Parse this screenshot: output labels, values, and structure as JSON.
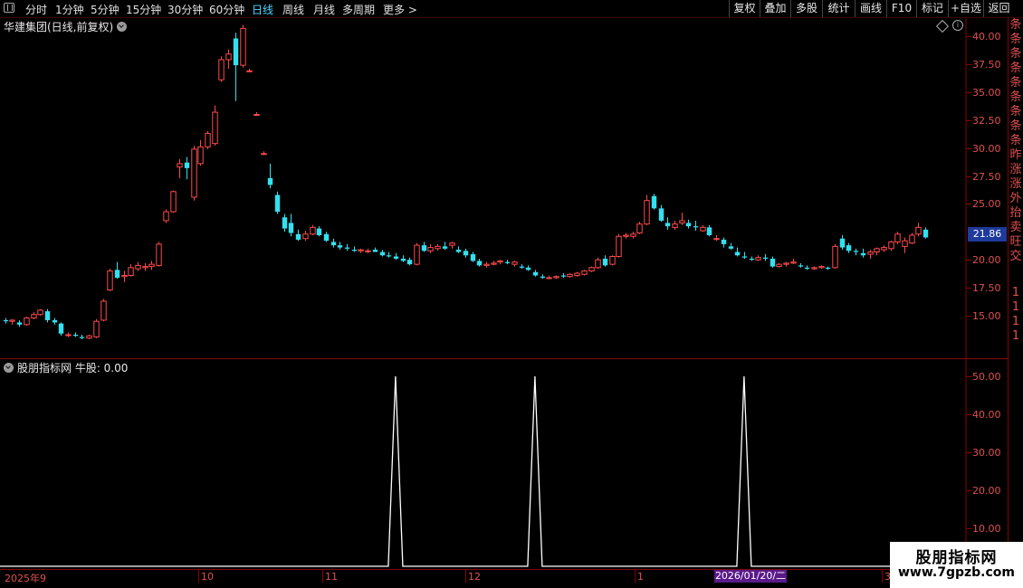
{
  "toolbar": {
    "tabs": [
      "分时",
      "1分钟",
      "5分钟",
      "15分钟",
      "30分钟",
      "60分钟",
      "日线",
      "周线",
      "月线",
      "多周期",
      "更多 >"
    ],
    "active_tab": "日线",
    "right_buttons": [
      "复权",
      "叠加",
      "多股",
      "统计",
      "画线",
      "F10",
      "标记",
      "+自选",
      "返回"
    ]
  },
  "main_chart": {
    "title": "华建集团(日线,前复权)",
    "current_price": "21.86",
    "y_ticks": [
      "40.00",
      "37.50",
      "35.00",
      "32.50",
      "30.00",
      "27.50",
      "25.00",
      "20.00",
      "17.50",
      "15.00"
    ]
  },
  "indicator": {
    "title": "股朋指标网  牛股: 0.00",
    "y_ticks": [
      "50.00",
      "40.00",
      "30.00",
      "20.00",
      "10.00"
    ]
  },
  "x_axis": {
    "labels": [
      "2025年9",
      "10",
      "11",
      "12",
      "1",
      "3"
    ],
    "highlight_date": "2026/01/20/二"
  },
  "side_column": [
    "条",
    "条",
    "条",
    "条",
    "条",
    "条",
    "条",
    "条",
    "条",
    "昨",
    "涨",
    "涨",
    "外",
    "抬",
    "卖",
    "旺",
    "交",
    "1",
    "1",
    "1",
    "1"
  ],
  "watermark": {
    "title": "股朋指标网",
    "url": "www.7gpzb.com"
  },
  "colors": {
    "up": "#ff4a4a",
    "down": "#33e0f0",
    "axis": "#8a0000",
    "text_axis": "#e05050",
    "active_tab": "#4fd7ff"
  },
  "chart_data": [
    {
      "type": "candlestick",
      "title": "华建集团(日线,前复权)",
      "ylim": [
        12.5,
        42.0
      ],
      "y_ticks": [
        15.0,
        17.5,
        20.0,
        22.5,
        25.0,
        27.5,
        30.0,
        32.5,
        35.0,
        37.5,
        40.0
      ],
      "ohlc": [
        [
          14.6,
          14.8,
          14.3,
          14.5
        ],
        [
          14.5,
          14.7,
          14.2,
          14.6
        ],
        [
          14.4,
          14.6,
          14.0,
          14.2
        ],
        [
          14.2,
          14.9,
          14.1,
          14.8
        ],
        [
          14.8,
          15.3,
          14.7,
          15.1
        ],
        [
          15.1,
          15.6,
          15.0,
          15.5
        ],
        [
          15.4,
          15.6,
          14.4,
          14.6
        ],
        [
          14.6,
          14.8,
          14.2,
          14.4
        ],
        [
          14.3,
          14.4,
          13.2,
          13.4
        ],
        [
          13.3,
          13.5,
          13.1,
          13.3
        ],
        [
          13.3,
          13.5,
          13.1,
          13.2
        ],
        [
          13.1,
          13.3,
          12.9,
          13.0
        ],
        [
          13.0,
          13.3,
          12.9,
          13.2
        ],
        [
          13.1,
          14.7,
          13.0,
          14.5
        ],
        [
          14.6,
          16.5,
          14.5,
          16.3
        ],
        [
          17.3,
          19.2,
          17.2,
          19.0
        ],
        [
          19.1,
          19.8,
          18.3,
          18.4
        ],
        [
          18.5,
          19.0,
          18.0,
          18.6
        ],
        [
          18.6,
          19.6,
          18.5,
          19.3
        ],
        [
          19.2,
          19.8,
          19.0,
          19.5
        ],
        [
          19.3,
          19.7,
          19.0,
          19.4
        ],
        [
          19.4,
          19.9,
          19.1,
          19.6
        ],
        [
          19.5,
          21.6,
          19.4,
          21.4
        ],
        [
          23.5,
          24.5,
          23.3,
          24.3
        ],
        [
          24.3,
          26.2,
          24.2,
          26.1
        ],
        [
          28.3,
          29.0,
          27.3,
          28.6
        ],
        [
          28.7,
          29.2,
          27.2,
          28.2
        ],
        [
          25.6,
          30.2,
          25.3,
          29.9
        ],
        [
          28.6,
          30.7,
          28.4,
          30.1
        ],
        [
          30.1,
          31.5,
          29.9,
          31.3
        ],
        [
          30.4,
          33.8,
          30.2,
          33.2
        ],
        [
          36.1,
          38.2,
          35.9,
          37.9
        ],
        [
          37.9,
          38.8,
          37.1,
          38.4
        ],
        [
          39.8,
          40.3,
          34.2,
          37.4
        ],
        [
          37.4,
          41.0,
          37.2,
          40.7
        ],
        [
          36.9,
          37.1,
          36.8,
          36.9
        ],
        [
          33.0,
          33.2,
          32.9,
          33.0
        ],
        [
          29.5,
          29.7,
          29.4,
          29.5
        ],
        [
          27.3,
          28.6,
          26.4,
          26.7
        ],
        [
          25.8,
          26.1,
          24.1,
          24.3
        ],
        [
          23.8,
          24.1,
          22.5,
          22.8
        ],
        [
          23.3,
          24.1,
          22.1,
          22.4
        ],
        [
          22.3,
          22.7,
          21.7,
          21.8
        ],
        [
          21.9,
          22.6,
          21.7,
          22.3
        ],
        [
          22.3,
          23.1,
          22.2,
          22.9
        ],
        [
          22.8,
          23.0,
          22.1,
          22.2
        ],
        [
          22.3,
          22.5,
          21.6,
          21.7
        ],
        [
          21.6,
          21.9,
          21.1,
          21.3
        ],
        [
          21.3,
          21.6,
          20.9,
          21.1
        ],
        [
          21.1,
          21.4,
          20.8,
          21.0
        ],
        [
          20.9,
          21.2,
          20.7,
          20.8
        ],
        [
          20.8,
          21.0,
          20.6,
          20.9
        ],
        [
          20.8,
          21.0,
          20.6,
          20.8
        ],
        [
          20.9,
          21.1,
          20.7,
          20.7
        ],
        [
          20.7,
          20.9,
          20.3,
          20.4
        ],
        [
          20.4,
          20.7,
          20.2,
          20.3
        ],
        [
          20.3,
          20.6,
          20.0,
          20.1
        ],
        [
          20.1,
          20.4,
          19.8,
          19.9
        ],
        [
          20.0,
          20.2,
          19.5,
          19.6
        ],
        [
          19.6,
          21.5,
          19.5,
          21.3
        ],
        [
          21.3,
          21.6,
          20.7,
          20.8
        ],
        [
          20.8,
          21.4,
          20.6,
          21.1
        ],
        [
          21.0,
          21.4,
          20.8,
          21.2
        ],
        [
          21.2,
          21.6,
          20.9,
          21.0
        ],
        [
          21.3,
          21.6,
          21.0,
          21.5
        ],
        [
          20.9,
          21.2,
          20.6,
          20.7
        ],
        [
          20.8,
          21.0,
          20.2,
          20.4
        ],
        [
          20.5,
          20.7,
          19.8,
          19.9
        ],
        [
          19.9,
          20.1,
          19.4,
          19.5
        ],
        [
          19.5,
          19.8,
          19.3,
          19.6
        ],
        [
          19.6,
          19.9,
          19.5,
          19.7
        ],
        [
          19.8,
          20.0,
          19.6,
          19.9
        ],
        [
          19.8,
          20.0,
          19.6,
          19.7
        ],
        [
          19.6,
          19.9,
          19.4,
          19.8
        ],
        [
          19.4,
          19.6,
          19.2,
          19.3
        ],
        [
          19.3,
          19.5,
          19.0,
          19.1
        ],
        [
          18.9,
          19.1,
          18.5,
          18.6
        ],
        [
          18.5,
          18.7,
          18.3,
          18.4
        ],
        [
          18.4,
          18.6,
          18.3,
          18.4
        ],
        [
          18.4,
          18.6,
          18.3,
          18.5
        ],
        [
          18.6,
          18.8,
          18.4,
          18.5
        ],
        [
          18.5,
          18.8,
          18.4,
          18.7
        ],
        [
          18.6,
          18.9,
          18.5,
          18.8
        ],
        [
          18.7,
          19.1,
          18.6,
          19.0
        ],
        [
          19.0,
          19.4,
          18.9,
          19.3
        ],
        [
          19.3,
          20.2,
          19.2,
          20.0
        ],
        [
          20.1,
          20.4,
          19.4,
          19.5
        ],
        [
          19.6,
          20.4,
          19.5,
          20.3
        ],
        [
          20.3,
          22.3,
          20.2,
          22.1
        ],
        [
          22.1,
          22.4,
          21.9,
          22.2
        ],
        [
          22.1,
          22.5,
          21.9,
          22.3
        ],
        [
          22.4,
          23.4,
          22.3,
          23.2
        ],
        [
          23.2,
          25.8,
          23.1,
          25.3
        ],
        [
          25.7,
          25.9,
          24.5,
          24.6
        ],
        [
          24.6,
          24.9,
          23.4,
          23.5
        ],
        [
          23.3,
          23.8,
          22.7,
          23.0
        ],
        [
          22.9,
          23.5,
          22.7,
          23.2
        ],
        [
          23.3,
          24.2,
          23.1,
          23.5
        ],
        [
          23.3,
          23.6,
          22.8,
          23.0
        ],
        [
          23.0,
          23.5,
          22.6,
          22.9
        ],
        [
          22.6,
          23.1,
          22.5,
          22.9
        ],
        [
          22.9,
          23.1,
          22.1,
          22.2
        ],
        [
          21.9,
          22.2,
          21.7,
          21.9
        ],
        [
          21.8,
          22.0,
          21.1,
          21.4
        ],
        [
          21.2,
          21.5,
          20.9,
          21.0
        ],
        [
          20.7,
          21.1,
          20.3,
          20.4
        ],
        [
          20.3,
          20.7,
          20.1,
          20.2
        ],
        [
          20.1,
          20.3,
          19.9,
          20.0
        ],
        [
          20.0,
          20.4,
          19.9,
          20.2
        ],
        [
          20.2,
          20.5,
          19.9,
          20.1
        ],
        [
          20.1,
          20.3,
          19.3,
          19.4
        ],
        [
          19.4,
          19.7,
          19.3,
          19.6
        ],
        [
          19.6,
          19.8,
          19.4,
          19.7
        ],
        [
          19.7,
          20.1,
          19.6,
          19.8
        ],
        [
          19.5,
          19.7,
          19.3,
          19.4
        ],
        [
          19.3,
          19.5,
          19.1,
          19.2
        ],
        [
          19.2,
          19.4,
          19.1,
          19.3
        ],
        [
          19.3,
          19.5,
          19.2,
          19.4
        ],
        [
          19.3,
          19.4,
          19.1,
          19.2
        ],
        [
          19.3,
          21.4,
          19.2,
          21.2
        ],
        [
          21.9,
          22.2,
          20.9,
          21.1
        ],
        [
          21.3,
          21.5,
          20.6,
          20.8
        ],
        [
          20.8,
          21.0,
          20.4,
          20.7
        ],
        [
          20.6,
          21.0,
          20.2,
          20.4
        ],
        [
          20.5,
          20.9,
          20.1,
          20.7
        ],
        [
          20.7,
          21.1,
          20.4,
          21.0
        ],
        [
          20.9,
          21.3,
          20.7,
          21.1
        ],
        [
          21.0,
          21.7,
          20.8,
          21.6
        ],
        [
          21.6,
          22.5,
          21.4,
          22.3
        ],
        [
          21.2,
          22.0,
          20.6,
          21.7
        ],
        [
          21.5,
          22.4,
          21.4,
          22.2
        ],
        [
          22.3,
          23.3,
          22.1,
          22.9
        ],
        [
          22.7,
          22.9,
          21.9,
          22.0
        ]
      ]
    },
    {
      "type": "line",
      "title": "股朋指标网  牛股: 0.00",
      "series": [
        {
          "name": "牛股",
          "spikes": [
            {
              "index": 56,
              "value": 50
            },
            {
              "index": 76,
              "value": 50
            },
            {
              "index": 106,
              "value": 50
            }
          ]
        }
      ],
      "ylim": [
        -10,
        52
      ],
      "y_ticks": [
        10,
        20,
        30,
        40,
        50
      ]
    }
  ]
}
